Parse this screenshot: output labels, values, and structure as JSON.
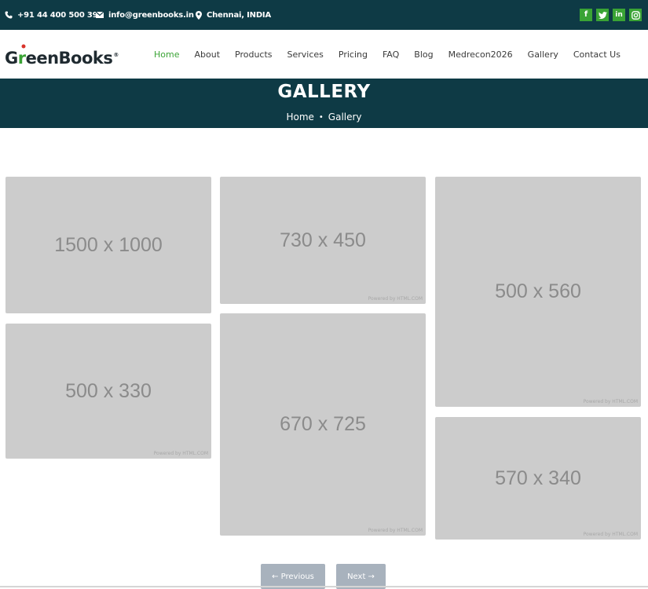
{
  "topbar": {
    "phone": "+91 44 400 500 39",
    "email": "info@greenbooks.in",
    "location": "Chennai, INDIA",
    "social": {
      "facebook": "f",
      "twitter": "t",
      "linkedin": "in",
      "instagram": "ig"
    }
  },
  "brand": {
    "logo_part1": "G",
    "logo_part2": "r",
    "logo_part3": "eenBooks",
    "registered": "®"
  },
  "nav": {
    "items": [
      "Home",
      "About",
      "Products",
      "Services",
      "Pricing",
      "FAQ",
      "Blog",
      "Medrecon2026",
      "Gallery",
      "Contact Us"
    ],
    "active": "Home"
  },
  "banner": {
    "title": "GALLERY",
    "breadcrumb_home": "Home",
    "breadcrumb_separator": "•",
    "breadcrumb_current": "Gallery"
  },
  "gallery": {
    "images": [
      {
        "label": "1500 x 1000",
        "credit": ""
      },
      {
        "label": "730 x 450",
        "credit": "Powered by HTML.COM"
      },
      {
        "label": "500 x 560",
        "credit": "Powered by HTML.COM"
      },
      {
        "label": "500 x 330",
        "credit": "Powered by HTML.COM"
      },
      {
        "label": "670 x 725",
        "credit": "Powered by HTML.COM"
      },
      {
        "label": "570 x 340",
        "credit": "Powered by HTML.COM"
      }
    ]
  },
  "pagination": {
    "previous": "← Previous",
    "next": "Next →"
  },
  "colors": {
    "header_bg": "#0e3a45",
    "accent_green": "#3aa335",
    "placeholder_gray": "#cccccc",
    "button_gray": "#a8b2bd"
  }
}
